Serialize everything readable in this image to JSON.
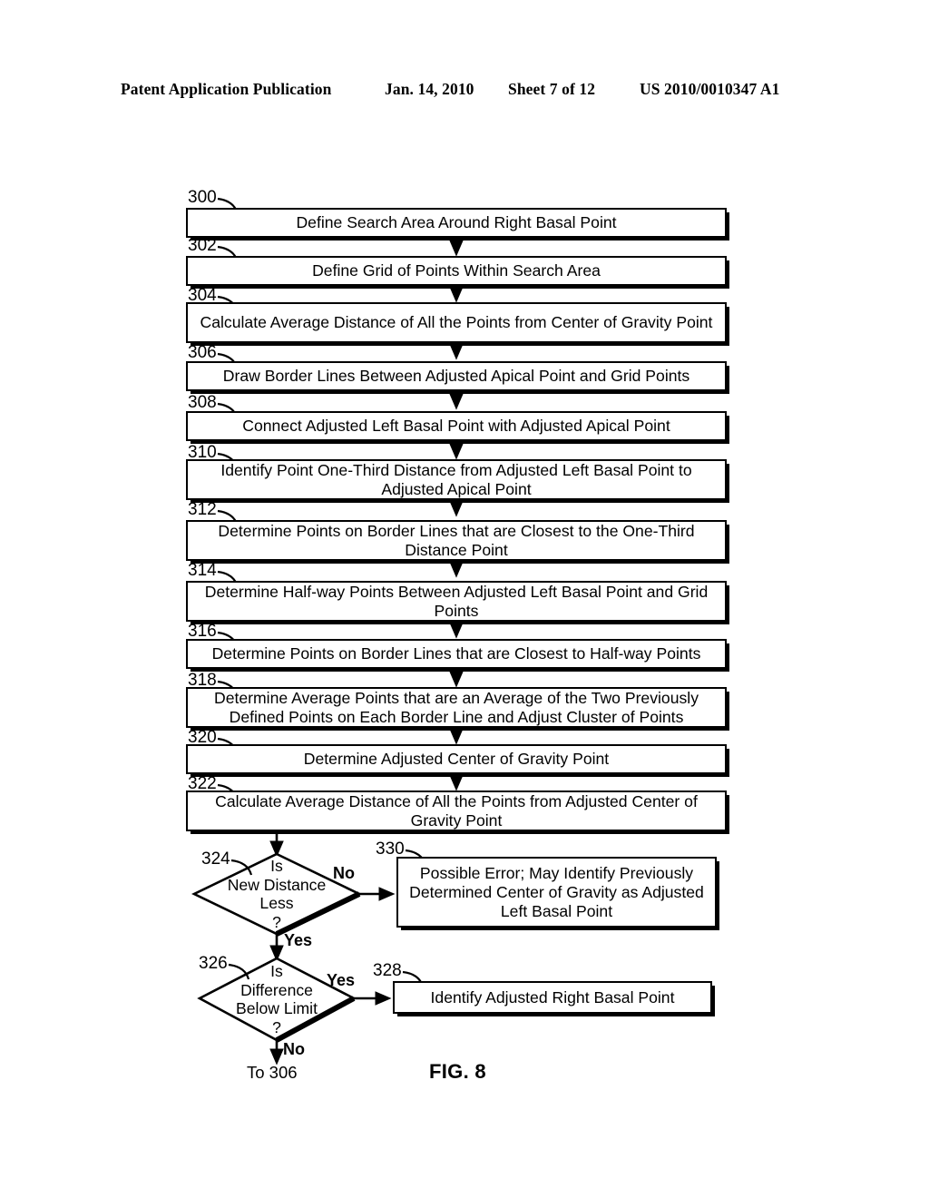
{
  "header": {
    "left": "Patent Application Publication",
    "date": "Jan. 14, 2010",
    "sheet": "Sheet 7 of 12",
    "patent_number": "US 2010/0010347 A1"
  },
  "figure": {
    "caption": "FIG. 8"
  },
  "flowchart": {
    "steps": [
      {
        "ref": "300",
        "text": "Define Search Area Around Right Basal Point"
      },
      {
        "ref": "302",
        "text": "Define Grid of Points Within Search Area"
      },
      {
        "ref": "304",
        "text": "Calculate Average Distance of All the Points from Center of Gravity Point"
      },
      {
        "ref": "306",
        "text": "Draw Border Lines Between Adjusted Apical Point and Grid Points"
      },
      {
        "ref": "308",
        "text": "Connect Adjusted Left Basal Point with Adjusted Apical Point"
      },
      {
        "ref": "310",
        "text": "Identify Point One-Third Distance from Adjusted Left Basal Point to Adjusted Apical Point"
      },
      {
        "ref": "312",
        "text": "Determine Points on Border Lines that are Closest to the One-Third Distance Point"
      },
      {
        "ref": "314",
        "text": "Determine Half-way Points Between Adjusted Left Basal Point and Grid Points"
      },
      {
        "ref": "316",
        "text": "Determine Points on Border Lines that are Closest to Half-way Points"
      },
      {
        "ref": "318",
        "text": "Determine Average Points that are an Average of the Two Previously Defined Points on Each Border Line and Adjust Cluster of Points"
      },
      {
        "ref": "320",
        "text": "Determine Adjusted Center of Gravity Point"
      },
      {
        "ref": "322",
        "text": "Calculate Average Distance of All the Points from Adjusted Center of Gravity Point"
      }
    ],
    "decisions": [
      {
        "ref": "324",
        "line1": "Is",
        "line2": "New Distance",
        "line3": "Less",
        "line4": "?",
        "branch_right": "No",
        "branch_down": "Yes"
      },
      {
        "ref": "326",
        "line1": "Is",
        "line2": "Difference",
        "line3": "Below Limit",
        "line4": "?",
        "branch_right": "Yes",
        "branch_down": "No"
      }
    ],
    "outcomes": [
      {
        "ref": "330",
        "text": "Possible Error; May Identify Previously Determined Center of Gravity as Adjusted Left Basal Point"
      },
      {
        "ref": "328",
        "text": "Identify Adjusted Right Basal Point"
      }
    ],
    "connector_note": "To 306"
  }
}
